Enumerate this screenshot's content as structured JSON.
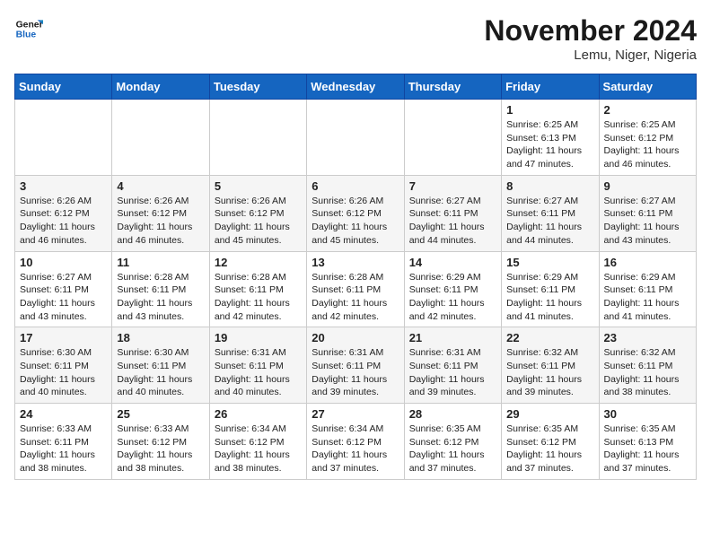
{
  "header": {
    "logo_line1": "General",
    "logo_line2": "Blue",
    "month_title": "November 2024",
    "location": "Lemu, Niger, Nigeria"
  },
  "days_of_week": [
    "Sunday",
    "Monday",
    "Tuesday",
    "Wednesday",
    "Thursday",
    "Friday",
    "Saturday"
  ],
  "weeks": [
    [
      {
        "day": "",
        "info": ""
      },
      {
        "day": "",
        "info": ""
      },
      {
        "day": "",
        "info": ""
      },
      {
        "day": "",
        "info": ""
      },
      {
        "day": "",
        "info": ""
      },
      {
        "day": "1",
        "info": "Sunrise: 6:25 AM\nSunset: 6:13 PM\nDaylight: 11 hours\nand 47 minutes."
      },
      {
        "day": "2",
        "info": "Sunrise: 6:25 AM\nSunset: 6:12 PM\nDaylight: 11 hours\nand 46 minutes."
      }
    ],
    [
      {
        "day": "3",
        "info": "Sunrise: 6:26 AM\nSunset: 6:12 PM\nDaylight: 11 hours\nand 46 minutes."
      },
      {
        "day": "4",
        "info": "Sunrise: 6:26 AM\nSunset: 6:12 PM\nDaylight: 11 hours\nand 46 minutes."
      },
      {
        "day": "5",
        "info": "Sunrise: 6:26 AM\nSunset: 6:12 PM\nDaylight: 11 hours\nand 45 minutes."
      },
      {
        "day": "6",
        "info": "Sunrise: 6:26 AM\nSunset: 6:12 PM\nDaylight: 11 hours\nand 45 minutes."
      },
      {
        "day": "7",
        "info": "Sunrise: 6:27 AM\nSunset: 6:11 PM\nDaylight: 11 hours\nand 44 minutes."
      },
      {
        "day": "8",
        "info": "Sunrise: 6:27 AM\nSunset: 6:11 PM\nDaylight: 11 hours\nand 44 minutes."
      },
      {
        "day": "9",
        "info": "Sunrise: 6:27 AM\nSunset: 6:11 PM\nDaylight: 11 hours\nand 43 minutes."
      }
    ],
    [
      {
        "day": "10",
        "info": "Sunrise: 6:27 AM\nSunset: 6:11 PM\nDaylight: 11 hours\nand 43 minutes."
      },
      {
        "day": "11",
        "info": "Sunrise: 6:28 AM\nSunset: 6:11 PM\nDaylight: 11 hours\nand 43 minutes."
      },
      {
        "day": "12",
        "info": "Sunrise: 6:28 AM\nSunset: 6:11 PM\nDaylight: 11 hours\nand 42 minutes."
      },
      {
        "day": "13",
        "info": "Sunrise: 6:28 AM\nSunset: 6:11 PM\nDaylight: 11 hours\nand 42 minutes."
      },
      {
        "day": "14",
        "info": "Sunrise: 6:29 AM\nSunset: 6:11 PM\nDaylight: 11 hours\nand 42 minutes."
      },
      {
        "day": "15",
        "info": "Sunrise: 6:29 AM\nSunset: 6:11 PM\nDaylight: 11 hours\nand 41 minutes."
      },
      {
        "day": "16",
        "info": "Sunrise: 6:29 AM\nSunset: 6:11 PM\nDaylight: 11 hours\nand 41 minutes."
      }
    ],
    [
      {
        "day": "17",
        "info": "Sunrise: 6:30 AM\nSunset: 6:11 PM\nDaylight: 11 hours\nand 40 minutes."
      },
      {
        "day": "18",
        "info": "Sunrise: 6:30 AM\nSunset: 6:11 PM\nDaylight: 11 hours\nand 40 minutes."
      },
      {
        "day": "19",
        "info": "Sunrise: 6:31 AM\nSunset: 6:11 PM\nDaylight: 11 hours\nand 40 minutes."
      },
      {
        "day": "20",
        "info": "Sunrise: 6:31 AM\nSunset: 6:11 PM\nDaylight: 11 hours\nand 39 minutes."
      },
      {
        "day": "21",
        "info": "Sunrise: 6:31 AM\nSunset: 6:11 PM\nDaylight: 11 hours\nand 39 minutes."
      },
      {
        "day": "22",
        "info": "Sunrise: 6:32 AM\nSunset: 6:11 PM\nDaylight: 11 hours\nand 39 minutes."
      },
      {
        "day": "23",
        "info": "Sunrise: 6:32 AM\nSunset: 6:11 PM\nDaylight: 11 hours\nand 38 minutes."
      }
    ],
    [
      {
        "day": "24",
        "info": "Sunrise: 6:33 AM\nSunset: 6:11 PM\nDaylight: 11 hours\nand 38 minutes."
      },
      {
        "day": "25",
        "info": "Sunrise: 6:33 AM\nSunset: 6:12 PM\nDaylight: 11 hours\nand 38 minutes."
      },
      {
        "day": "26",
        "info": "Sunrise: 6:34 AM\nSunset: 6:12 PM\nDaylight: 11 hours\nand 38 minutes."
      },
      {
        "day": "27",
        "info": "Sunrise: 6:34 AM\nSunset: 6:12 PM\nDaylight: 11 hours\nand 37 minutes."
      },
      {
        "day": "28",
        "info": "Sunrise: 6:35 AM\nSunset: 6:12 PM\nDaylight: 11 hours\nand 37 minutes."
      },
      {
        "day": "29",
        "info": "Sunrise: 6:35 AM\nSunset: 6:12 PM\nDaylight: 11 hours\nand 37 minutes."
      },
      {
        "day": "30",
        "info": "Sunrise: 6:35 AM\nSunset: 6:13 PM\nDaylight: 11 hours\nand 37 minutes."
      }
    ]
  ]
}
